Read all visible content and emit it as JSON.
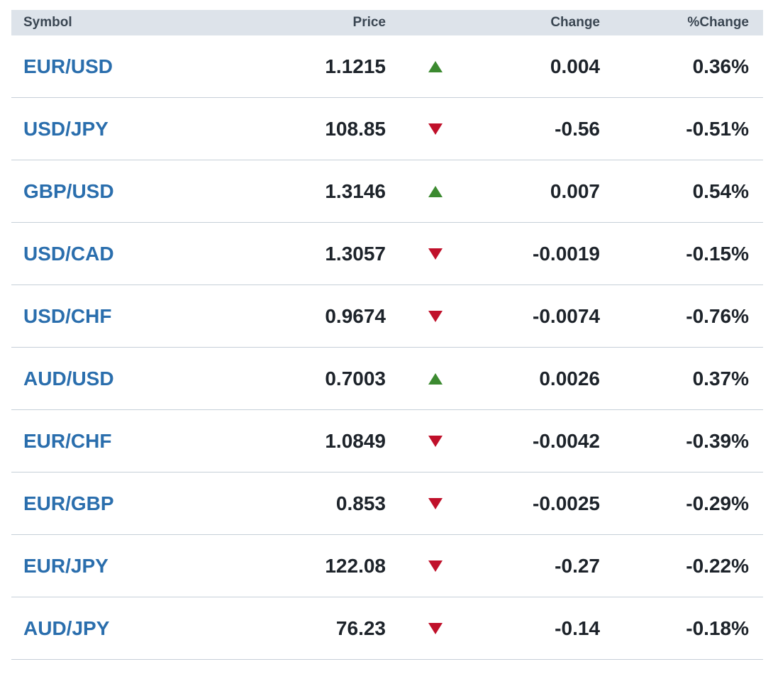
{
  "columns": {
    "symbol": "Symbol",
    "price": "Price",
    "change": "Change",
    "pct_change": "%Change"
  },
  "colors": {
    "symbol_link": "#2a6ead",
    "up": "#3c8a30",
    "down": "#c0102a",
    "header_bg": "#dde3ea"
  },
  "rows": [
    {
      "symbol": "EUR/USD",
      "price": "1.1215",
      "direction": "up",
      "change": "0.004",
      "pct_change": "0.36%"
    },
    {
      "symbol": "USD/JPY",
      "price": "108.85",
      "direction": "down",
      "change": "-0.56",
      "pct_change": "-0.51%"
    },
    {
      "symbol": "GBP/USD",
      "price": "1.3146",
      "direction": "up",
      "change": "0.007",
      "pct_change": "0.54%"
    },
    {
      "symbol": "USD/CAD",
      "price": "1.3057",
      "direction": "down",
      "change": "-0.0019",
      "pct_change": "-0.15%"
    },
    {
      "symbol": "USD/CHF",
      "price": "0.9674",
      "direction": "down",
      "change": "-0.0074",
      "pct_change": "-0.76%"
    },
    {
      "symbol": "AUD/USD",
      "price": "0.7003",
      "direction": "up",
      "change": "0.0026",
      "pct_change": "0.37%"
    },
    {
      "symbol": "EUR/CHF",
      "price": "1.0849",
      "direction": "down",
      "change": "-0.0042",
      "pct_change": "-0.39%"
    },
    {
      "symbol": "EUR/GBP",
      "price": "0.853",
      "direction": "down",
      "change": "-0.0025",
      "pct_change": "-0.29%"
    },
    {
      "symbol": "EUR/JPY",
      "price": "122.08",
      "direction": "down",
      "change": "-0.27",
      "pct_change": "-0.22%"
    },
    {
      "symbol": "AUD/JPY",
      "price": "76.23",
      "direction": "down",
      "change": "-0.14",
      "pct_change": "-0.18%"
    }
  ]
}
